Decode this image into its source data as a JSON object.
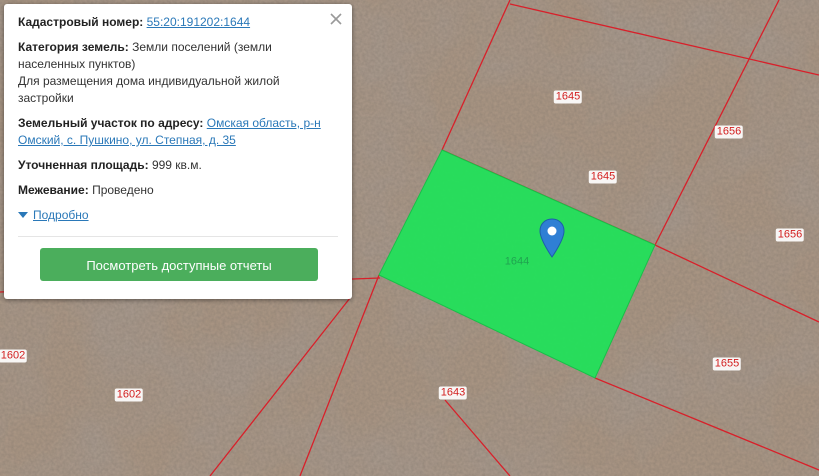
{
  "popup": {
    "cadastral_label": "Кадастровый номер:",
    "cadastral_value": "55:20:191202:1644",
    "category_label": "Категория земель:",
    "category_value": "Земли поселений (земли населенных пунктов)",
    "usage_value": "Для размещения дома индивидуальной жилой застройки",
    "address_label": "Земельный участок по адресу:",
    "address_value": "Омская область, р-н Омский, с. Пушкино, ул. Степная, д. 35",
    "area_label": "Уточненная площадь:",
    "area_value": "999 кв.м.",
    "survey_label": "Межевание:",
    "survey_value": "Проведено",
    "details_link": "Подробно",
    "reports_button": "Посмотреть доступные отчеты",
    "close_icon": "close-icon"
  },
  "map": {
    "plot_labels": {
      "p1645a": "1645",
      "p1645b": "1645",
      "p1656a": "1656",
      "p1656b": "1656",
      "p1644": "1644",
      "p1655": "1655",
      "p1643": "1643",
      "p1602a": "1602",
      "p1602b": "1602"
    },
    "selected_color": "#22e05a",
    "boundary_color": "#d8202a",
    "marker_icon": "map-pin-icon"
  }
}
